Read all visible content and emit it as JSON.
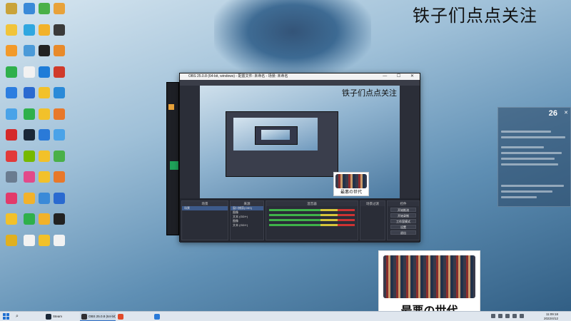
{
  "overlay_title": "铁子们点点关注",
  "desktop": {
    "icons": [
      {
        "label": "",
        "color": "#c9a33a"
      },
      {
        "label": "",
        "color": "#f1c43a"
      },
      {
        "label": "",
        "color": "#f29a2a"
      },
      {
        "label": "",
        "color": "#2fb04b"
      },
      {
        "label": "",
        "color": "#2c7ee0"
      },
      {
        "label": "",
        "color": "#4aa3e8"
      },
      {
        "label": "",
        "color": "#d42a2a"
      },
      {
        "label": "",
        "color": "#e23a3a"
      },
      {
        "label": "",
        "color": "#6a7c90"
      },
      {
        "label": "",
        "color": "#e23a6a"
      },
      {
        "label": "",
        "color": "#f2c12a"
      },
      {
        "label": "",
        "color": "#e0b020"
      },
      {
        "label": "",
        "color": "#3a8ad8"
      },
      {
        "label": "",
        "color": "#2fa7e0"
      },
      {
        "label": "",
        "color": "#4a9ad8"
      },
      {
        "label": "",
        "color": "#f2f2f2"
      },
      {
        "label": "",
        "color": "#2a6ad0"
      },
      {
        "label": "",
        "color": "#2fb04b"
      },
      {
        "label": "",
        "color": "#1b2838"
      },
      {
        "label": "",
        "color": "#76b900"
      },
      {
        "label": "",
        "color": "#e24a8a"
      },
      {
        "label": "",
        "color": "#f2b22a"
      },
      {
        "label": "",
        "color": "#2fb04b"
      },
      {
        "label": "",
        "color": "#f2f2f2"
      },
      {
        "label": "",
        "color": "#4ab048"
      },
      {
        "label": "",
        "color": "#f2b22a"
      },
      {
        "label": "",
        "color": "#222222"
      },
      {
        "label": "",
        "color": "#1e7cd8"
      },
      {
        "label": "",
        "color": "#f2c12a"
      },
      {
        "label": "",
        "color": "#f2c12a"
      },
      {
        "label": "",
        "color": "#2a7ad8"
      },
      {
        "label": "",
        "color": "#f2c12a"
      },
      {
        "label": "",
        "color": "#f2c12a"
      },
      {
        "label": "",
        "color": "#3a8ad8"
      },
      {
        "label": "",
        "color": "#f2b22a"
      },
      {
        "label": "",
        "color": "#f2c12a"
      },
      {
        "label": "",
        "color": "#e8a23a"
      },
      {
        "label": "",
        "color": "#3a3a3a"
      },
      {
        "label": "",
        "color": "#e88a2a"
      },
      {
        "label": "",
        "color": "#d03a2a"
      },
      {
        "label": "",
        "color": "#2a8ad8"
      },
      {
        "label": "",
        "color": "#e8782a"
      },
      {
        "label": "",
        "color": "#4aa3e8"
      },
      {
        "label": "",
        "color": "#4ab048"
      },
      {
        "label": "",
        "color": "#e8782a"
      },
      {
        "label": "",
        "color": "#2a6ad0"
      },
      {
        "label": "",
        "color": "#222222"
      },
      {
        "label": "",
        "color": "#f2f2f2"
      }
    ]
  },
  "obs": {
    "title": "OBS 25.0.8 (64-bit, windows) - 配置文件: 未命名 - 场景: 未命名",
    "preview_title": "铁子们点点关注",
    "panel_scenes": {
      "header": "场景",
      "rows": [
        "场景"
      ]
    },
    "panel_sources": {
      "header": "来源",
      "rows": [
        "窗口捕获(OBS)",
        "图像",
        "文本 (GDI+)",
        "图像",
        "文本 (GDI+)"
      ]
    },
    "panel_mixer": {
      "header": "混音器"
    },
    "panel_transitions": {
      "header": "场景过渡"
    },
    "panel_controls": {
      "header": "控件",
      "buttons": [
        "开始推流",
        "开始录制",
        "工作室模式",
        "设置",
        "退出"
      ]
    }
  },
  "poster": {
    "caption": "最悪の世代"
  },
  "widget": {
    "clock": "26"
  },
  "taskbar": {
    "items": [
      {
        "label": "Steam",
        "color": "#1b2838",
        "active": false
      },
      {
        "label": "OBS 25.0.8 (64-bit)...",
        "color": "#302e31",
        "active": true
      },
      {
        "label": "",
        "color": "#e24a2a",
        "active": false
      },
      {
        "label": "",
        "color": "#2a7ad8",
        "active": false
      }
    ],
    "time": "11:09:18",
    "date": "2022/4/12"
  }
}
